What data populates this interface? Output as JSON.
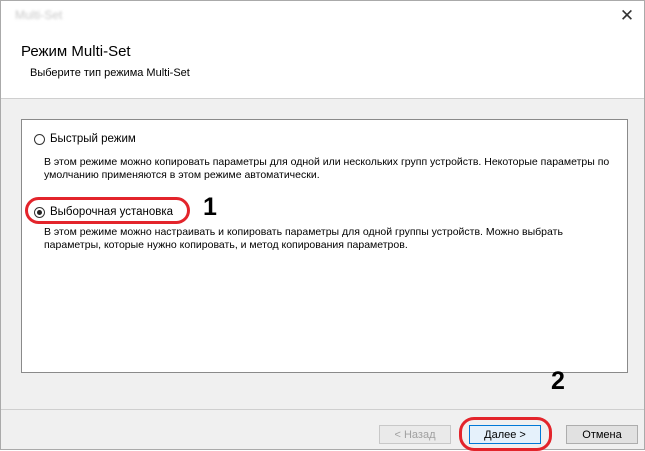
{
  "window": {
    "title": "Multi-Set",
    "close_icon": "close-icon"
  },
  "header": {
    "title": "Режим Multi-Set",
    "subtitle": "Выберите тип режима Multi-Set"
  },
  "options": [
    {
      "label": "Быстрый режим",
      "selected": false,
      "description": "В этом режиме можно копировать параметры для одной или нескольких групп устройств. Некоторые параметры по умолчанию применяются в этом режиме автоматически."
    },
    {
      "label": "Выборочная установка",
      "selected": true,
      "description": "В этом режиме можно настраивать и копировать параметры для одной группы устройств. Можно выбрать параметры, которые нужно копировать, и метод копирования параметров."
    }
  ],
  "annotations": {
    "step1": "1",
    "step2": "2",
    "highlight_color": "#e3242b"
  },
  "footer": {
    "back_label": "< Назад",
    "next_label": "Далее >",
    "cancel_label": "Отмена"
  }
}
